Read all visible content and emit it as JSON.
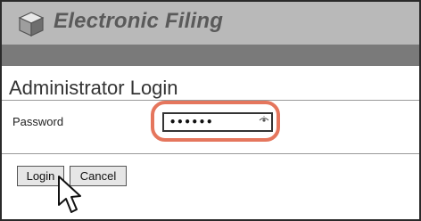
{
  "header": {
    "logo_icon": "cube-logo-icon",
    "app_title": "Electronic Filing"
  },
  "main": {
    "page_title": "Administrator Login",
    "password": {
      "label": "Password",
      "masked_value": "••••••",
      "icon": "eye-icon"
    },
    "buttons": {
      "login": "Login",
      "cancel": "Cancel"
    }
  },
  "annotation": {
    "highlight_color": "#e5765d",
    "cursor_icon": "arrow-pointer-icon"
  }
}
